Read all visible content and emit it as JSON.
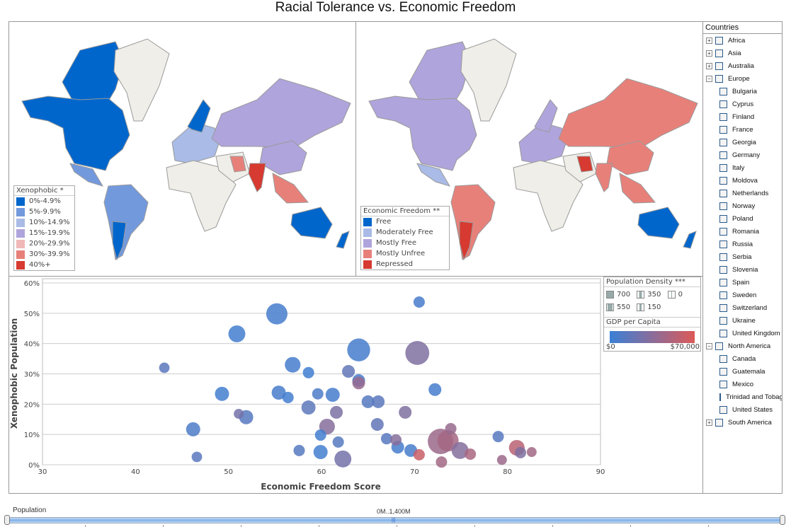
{
  "title": "Racial Tolerance vs. Economic Freedom",
  "xenophobic_legend": {
    "title": "Xenophobic *",
    "items": [
      {
        "label": "0%-4.9%",
        "color": "#0066cc"
      },
      {
        "label": "5%-9.9%",
        "color": "#7399dd"
      },
      {
        "label": "10%-14.9%",
        "color": "#a9bbe6"
      },
      {
        "label": "15%-19.9%",
        "color": "#b0a4dc"
      },
      {
        "label": "20%-29.9%",
        "color": "#f0b8b8"
      },
      {
        "label": "30%-39.9%",
        "color": "#e8807a"
      },
      {
        "label": "40%+",
        "color": "#d63a30"
      }
    ]
  },
  "freedom_legend": {
    "title": "Economic Freedom **",
    "items": [
      {
        "label": "Free",
        "color": "#0066cc"
      },
      {
        "label": "Moderately Free",
        "color": "#a9bbe6"
      },
      {
        "label": "Mostly Free",
        "color": "#b0a4dc"
      },
      {
        "label": "Mostly Unfree",
        "color": "#e8807a"
      },
      {
        "label": "Repressed",
        "color": "#d63a30"
      }
    ]
  },
  "sidebar": {
    "title": "Countries",
    "nodes": [
      {
        "label": "Africa",
        "type": "group",
        "state": "collapsed"
      },
      {
        "label": "Asia",
        "type": "group",
        "state": "collapsed"
      },
      {
        "label": "Australia",
        "type": "group",
        "state": "collapsed"
      },
      {
        "label": "Europe",
        "type": "group",
        "state": "expanded"
      },
      {
        "label": "Bulgaria",
        "type": "child"
      },
      {
        "label": "Cyprus",
        "type": "child"
      },
      {
        "label": "Finland",
        "type": "child"
      },
      {
        "label": "France",
        "type": "child"
      },
      {
        "label": "Georgia",
        "type": "child"
      },
      {
        "label": "Germany",
        "type": "child"
      },
      {
        "label": "Italy",
        "type": "child"
      },
      {
        "label": "Moldova",
        "type": "child"
      },
      {
        "label": "Netherlands",
        "type": "child"
      },
      {
        "label": "Norway",
        "type": "child"
      },
      {
        "label": "Poland",
        "type": "child"
      },
      {
        "label": "Romania",
        "type": "child"
      },
      {
        "label": "Russia",
        "type": "child"
      },
      {
        "label": "Serbia",
        "type": "child"
      },
      {
        "label": "Slovenia",
        "type": "child"
      },
      {
        "label": "Spain",
        "type": "child"
      },
      {
        "label": "Sweden",
        "type": "child"
      },
      {
        "label": "Switzerland",
        "type": "child"
      },
      {
        "label": "Ukraine",
        "type": "child"
      },
      {
        "label": "United Kingdom",
        "type": "child"
      },
      {
        "label": "North America",
        "type": "group",
        "state": "expanded"
      },
      {
        "label": "Canada",
        "type": "child"
      },
      {
        "label": "Guatemala",
        "type": "child"
      },
      {
        "label": "Mexico",
        "type": "child"
      },
      {
        "label": "Trinidad and Tobago",
        "type": "child"
      },
      {
        "label": "United States",
        "type": "child"
      },
      {
        "label": "South America",
        "type": "group",
        "state": "collapsed"
      }
    ]
  },
  "pop_legend": {
    "title": "Population Density ***",
    "items": [
      "700",
      "350",
      "0",
      "550",
      "150"
    ],
    "gdp_title": "GDP per Capita",
    "gdp_min": "$0",
    "gdp_max": "$70,000",
    "gdp_colors": [
      "#3a80d6",
      "#dc5a58"
    ]
  },
  "slider": {
    "label": "Population",
    "range": "0M..1,400M"
  },
  "chart_data": {
    "type": "scatter",
    "xlabel": "Economic Freedom Score",
    "ylabel": "Xenophobic Population",
    "xlim": [
      30,
      90
    ],
    "ylim": [
      0,
      60
    ],
    "xticks": [
      "30",
      "40",
      "50",
      "60",
      "70",
      "80",
      "90"
    ],
    "yticks": [
      "0%",
      "10%",
      "20%",
      "30%",
      "40%",
      "50%",
      "60%"
    ],
    "grid": "horizontal",
    "points": [
      {
        "x": 43.1,
        "y": 32,
        "pop": 16,
        "gdp": 14000
      },
      {
        "x": 46.6,
        "y": 2.6,
        "pop": 16,
        "gdp": 14000
      },
      {
        "x": 46.2,
        "y": 11.7,
        "pop": 130,
        "gdp": 8000
      },
      {
        "x": 49.3,
        "y": 23.4,
        "pop": 130,
        "gdp": 4000
      },
      {
        "x": 50.9,
        "y": 43.2,
        "pop": 290,
        "gdp": 4000
      },
      {
        "x": 51.1,
        "y": 16.8,
        "pop": 8,
        "gdp": 25000
      },
      {
        "x": 51.9,
        "y": 15.7,
        "pop": 130,
        "gdp": 12000
      },
      {
        "x": 55.2,
        "y": 49.8,
        "pop": 660,
        "gdp": 5000
      },
      {
        "x": 55.4,
        "y": 23.8,
        "pop": 130,
        "gdp": 6000
      },
      {
        "x": 56.4,
        "y": 22.2,
        "pop": 33,
        "gdp": 4000
      },
      {
        "x": 56.9,
        "y": 33,
        "pop": 210,
        "gdp": 5000
      },
      {
        "x": 57.6,
        "y": 4.7,
        "pop": 33,
        "gdp": 12000
      },
      {
        "x": 58.6,
        "y": 30.4,
        "pop": 33,
        "gdp": 3000
      },
      {
        "x": 58.6,
        "y": 18.9,
        "pop": 130,
        "gdp": 15000
      },
      {
        "x": 59.6,
        "y": 23.4,
        "pop": 33,
        "gdp": 8000
      },
      {
        "x": 59.9,
        "y": 9.8,
        "pop": 33,
        "gdp": 4000
      },
      {
        "x": 59.9,
        "y": 4.2,
        "pop": 130,
        "gdp": 4000
      },
      {
        "x": 60.6,
        "y": 12.6,
        "pop": 210,
        "gdp": 33000
      },
      {
        "x": 61.2,
        "y": 23.1,
        "pop": 130,
        "gdp": 5000
      },
      {
        "x": 61.6,
        "y": 17.3,
        "pop": 75,
        "gdp": 28000
      },
      {
        "x": 61.8,
        "y": 7.5,
        "pop": 33,
        "gdp": 12000
      },
      {
        "x": 62.3,
        "y": 1.9,
        "pop": 290,
        "gdp": 25000
      },
      {
        "x": 62.9,
        "y": 30.8,
        "pop": 75,
        "gdp": 17000
      },
      {
        "x": 64.0,
        "y": 37.9,
        "pop": 850,
        "gdp": 5000
      },
      {
        "x": 64.0,
        "y": 27.8,
        "pop": 75,
        "gdp": 6000
      },
      {
        "x": 64.0,
        "y": 27,
        "pop": 75,
        "gdp": 40000
      },
      {
        "x": 65.0,
        "y": 20.8,
        "pop": 75,
        "gdp": 12000
      },
      {
        "x": 66.1,
        "y": 20.8,
        "pop": 75,
        "gdp": 14000
      },
      {
        "x": 66.0,
        "y": 13.3,
        "pop": 75,
        "gdp": 17000
      },
      {
        "x": 67.0,
        "y": 8.6,
        "pop": 33,
        "gdp": 13000
      },
      {
        "x": 68.0,
        "y": 8.2,
        "pop": 33,
        "gdp": 33000
      },
      {
        "x": 68.2,
        "y": 5.8,
        "pop": 75,
        "gdp": 5000
      },
      {
        "x": 69.0,
        "y": 17.3,
        "pop": 75,
        "gdp": 30000
      },
      {
        "x": 69.6,
        "y": 4.7,
        "pop": 75,
        "gdp": 6000
      },
      {
        "x": 70.5,
        "y": 53.7,
        "pop": 33,
        "gdp": 6000
      },
      {
        "x": 70.3,
        "y": 36.9,
        "pop": 970,
        "gdp": 30000
      },
      {
        "x": 70.5,
        "y": 3.3,
        "pop": 33,
        "gdp": 62000
      },
      {
        "x": 72.2,
        "y": 24.8,
        "pop": 75,
        "gdp": 5000
      },
      {
        "x": 72.9,
        "y": 0.9,
        "pop": 33,
        "gdp": 45000
      },
      {
        "x": 72.8,
        "y": 7.7,
        "pop": 1180,
        "gdp": 42000
      },
      {
        "x": 73.6,
        "y": 7.9,
        "pop": 660,
        "gdp": 46000
      },
      {
        "x": 73.9,
        "y": 11.9,
        "pop": 33,
        "gdp": 40000
      },
      {
        "x": 74.9,
        "y": 4.7,
        "pop": 290,
        "gdp": 32000
      },
      {
        "x": 76.0,
        "y": 3.5,
        "pop": 33,
        "gdp": 48000
      },
      {
        "x": 79.0,
        "y": 9.3,
        "pop": 33,
        "gdp": 13000
      },
      {
        "x": 79.4,
        "y": 1.6,
        "pop": 8,
        "gdp": 42000
      },
      {
        "x": 81.0,
        "y": 5.6,
        "pop": 210,
        "gdp": 55000
      },
      {
        "x": 81.4,
        "y": 4.0,
        "pop": 33,
        "gdp": 30000
      },
      {
        "x": 82.6,
        "y": 4.2,
        "pop": 8,
        "gdp": 45000
      }
    ]
  }
}
